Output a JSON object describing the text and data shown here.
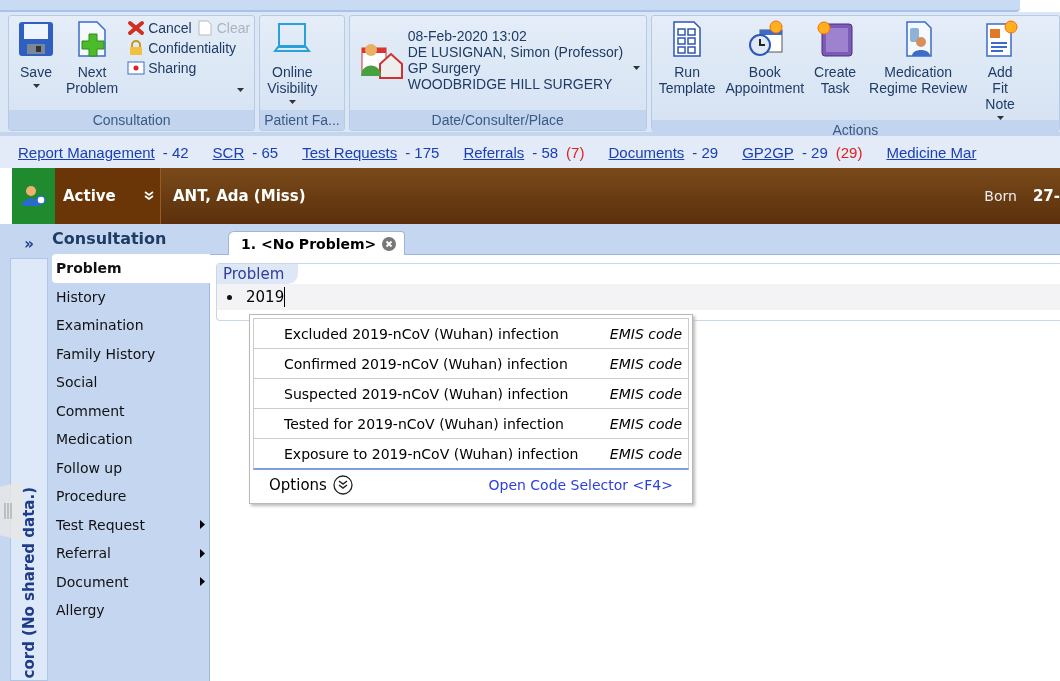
{
  "ribbon": {
    "groups": [
      {
        "label": "Consultation",
        "buttons": [
          {
            "kind": "save",
            "label": "Save",
            "dropdown": true
          },
          {
            "kind": "next",
            "label": "Next Problem",
            "dropdown": false
          }
        ],
        "small_buttons": [
          {
            "kind": "cancel",
            "label": "Cancel",
            "disabled": false
          },
          {
            "kind": "clear",
            "label": "Clear",
            "disabled": true
          },
          {
            "kind": "lock",
            "label": "Confidentiality",
            "disabled": false
          },
          {
            "kind": "sharing",
            "label": "Sharing",
            "disabled": false
          }
        ],
        "menu_dropdown": true
      },
      {
        "label": "Patient Fa...",
        "buttons": [
          {
            "kind": "online",
            "label": "Online Visibility",
            "dropdown": true
          }
        ]
      },
      {
        "label": "Date/Consulter/Place",
        "consulter": {
          "lines": [
            "08-Feb-2020 13:02",
            "DE LUSIGNAN, Simon (Professor)",
            "GP Surgery",
            "WOODBRIDGE HILL SURGERY"
          ]
        }
      },
      {
        "label": "Actions",
        "buttons": [
          {
            "kind": "template",
            "label": "Run Template",
            "dropdown": false
          },
          {
            "kind": "appointment",
            "label": "Book Appointment",
            "dropdown": false
          },
          {
            "kind": "task",
            "label": "Create Task",
            "dropdown": false
          },
          {
            "kind": "review",
            "label": "Medication Regime Review",
            "dropdown": false
          },
          {
            "kind": "fitnote",
            "label": "Add Fit Note",
            "dropdown": true
          }
        ]
      }
    ]
  },
  "links": [
    {
      "label": "Report Management",
      "count": "- 42"
    },
    {
      "label": "SCR",
      "count": "- 65"
    },
    {
      "label": "Test Requests",
      "count": "- 175"
    },
    {
      "label": "Referrals",
      "count": "- 58",
      "alert": "(7)"
    },
    {
      "label": "Documents",
      "count": "- 29"
    },
    {
      "label": "GP2GP",
      "count": "- 29",
      "alert": "(29)"
    },
    {
      "label": "Medicine Mar"
    }
  ],
  "patient_bar": {
    "status": "Active",
    "name": "ANT, Ada (Miss)",
    "born_label": "Born",
    "born_value": "27-"
  },
  "side_strip": {
    "expand": "»",
    "vertical_text": "cord (No shared data.)"
  },
  "consultation": {
    "title": "Consultation",
    "items": [
      {
        "label": "Problem",
        "selected": true,
        "submenu": false
      },
      {
        "label": "History",
        "selected": false,
        "submenu": false
      },
      {
        "label": "Examination",
        "selected": false,
        "submenu": false
      },
      {
        "label": "Family History",
        "selected": false,
        "submenu": false
      },
      {
        "label": "Social",
        "selected": false,
        "submenu": false
      },
      {
        "label": "Comment",
        "selected": false,
        "submenu": false
      },
      {
        "label": "Medication",
        "selected": false,
        "submenu": false
      },
      {
        "label": "Follow up",
        "selected": false,
        "submenu": false
      },
      {
        "label": "Procedure",
        "selected": false,
        "submenu": false
      },
      {
        "label": "Test Request",
        "selected": false,
        "submenu": true
      },
      {
        "label": "Referral",
        "selected": false,
        "submenu": true
      },
      {
        "label": "Document",
        "selected": false,
        "submenu": true
      },
      {
        "label": "Allergy",
        "selected": false,
        "submenu": false
      }
    ]
  },
  "tab": {
    "label": "1. <No Problem>"
  },
  "problem": {
    "section": "Problem",
    "value": "2019"
  },
  "suggestions": {
    "items": [
      {
        "term": "Excluded 2019-nCoV (Wuhan) infection",
        "source": "EMIS code"
      },
      {
        "term": "Confirmed 2019-nCoV (Wuhan) infection",
        "source": "EMIS code"
      },
      {
        "term": "Suspected 2019-nCoV (Wuhan) infection",
        "source": "EMIS code"
      },
      {
        "term": "Tested for 2019-nCoV (Wuhan) infection",
        "source": "EMIS code"
      },
      {
        "term": "Exposure to 2019-nCoV (Wuhan) infection",
        "source": "EMIS code"
      }
    ],
    "options": "Options",
    "selector_link": "Open Code Selector <F4>"
  }
}
